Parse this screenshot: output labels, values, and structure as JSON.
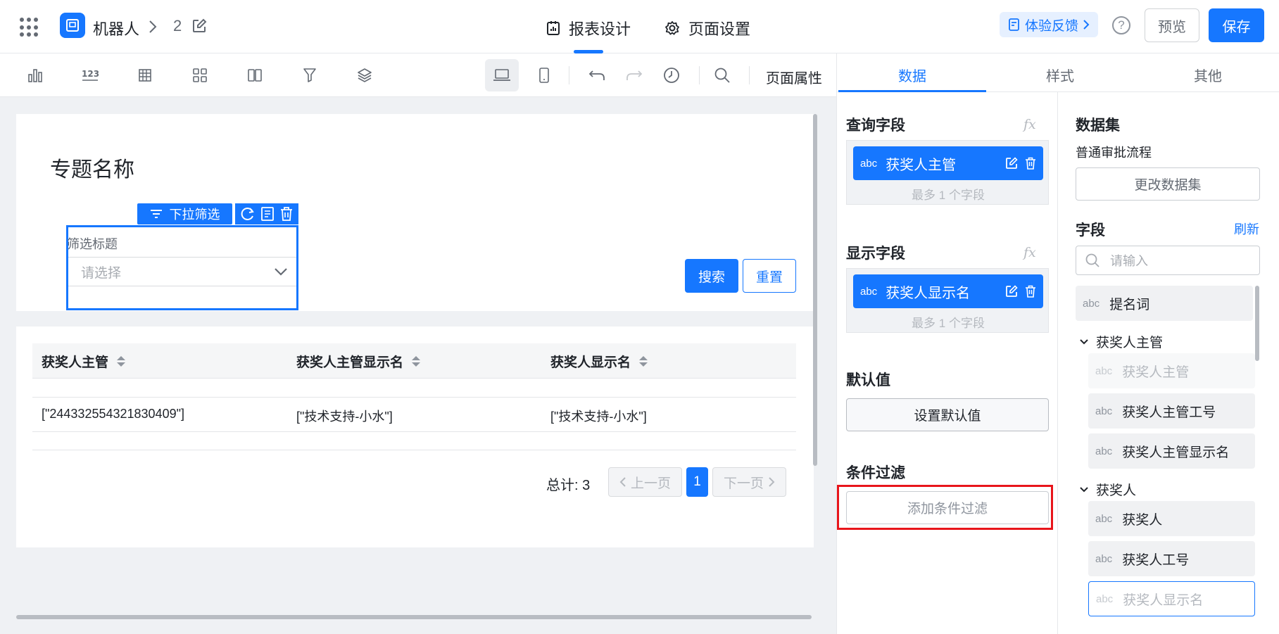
{
  "header": {
    "app_name": "机器人",
    "page_number": "2",
    "tabs": [
      {
        "label": "报表设计",
        "icon": "report-icon",
        "active": true
      },
      {
        "label": "页面设置",
        "icon": "gear-icon",
        "active": false
      }
    ],
    "feedback_label": "体验反馈",
    "help_label": "?",
    "preview_label": "预览",
    "save_label": "保存",
    "accent_color": "#1677ff"
  },
  "toolbar": {
    "icons": [
      "bar-chart-icon",
      "number-icon",
      "table-icon",
      "grid-icon",
      "columns-icon",
      "filter-icon",
      "layers-icon",
      "desktop-icon",
      "mobile-icon",
      "undo-icon",
      "redo-icon",
      "history-icon",
      "search-icon"
    ],
    "page_properties_label": "页面属性"
  },
  "canvas": {
    "title": "专题名称",
    "filter_widget": {
      "tag_label": "下拉筛选",
      "title": "筛选标题",
      "placeholder": "请选择"
    },
    "search_label": "搜索",
    "reset_label": "重置",
    "table": {
      "columns": [
        "获奖人主管",
        "获奖人主管显示名",
        "获奖人显示名"
      ],
      "rows": [
        [
          "[\"244332554321830409\"]",
          "[\"技术支持-小水\"]",
          "[\"技术支持-小水\"]"
        ]
      ]
    },
    "pagination": {
      "total_label": "总计: 3",
      "prev_label": "上一页",
      "current_page": "1",
      "next_label": "下一页"
    }
  },
  "right_panel": {
    "tabs": [
      "数据",
      "样式",
      "其他"
    ],
    "active_tab": "数据",
    "query_fields": {
      "title": "查询字段",
      "fx": "fx",
      "field_type": "abc",
      "field_label": "获奖人主管",
      "hint": "最多 1 个字段"
    },
    "display_fields": {
      "title": "显示字段",
      "fx": "fx",
      "field_type": "abc",
      "field_label": "获奖人显示名",
      "hint": "最多 1 个字段"
    },
    "default_value": {
      "title": "默认值",
      "button_label": "设置默认值"
    },
    "condition_filter": {
      "title": "条件过滤",
      "button_label": "添加条件过滤",
      "highlight_color": "#e8151b"
    },
    "dataset": {
      "title": "数据集",
      "name": "普通审批流程",
      "change_label": "更改数据集"
    },
    "fields": {
      "title": "字段",
      "refresh_label": "刷新",
      "search_placeholder": "请输入",
      "top_item": {
        "type": "abc",
        "label": "提名词"
      },
      "groups": [
        {
          "label": "获奖人主管",
          "items": [
            {
              "type": "abc",
              "label": "获奖人主管",
              "state": "disabled"
            },
            {
              "type": "abc",
              "label": "获奖人主管工号",
              "state": "normal"
            },
            {
              "type": "abc",
              "label": "获奖人主管显示名",
              "state": "normal"
            }
          ]
        },
        {
          "label": "获奖人",
          "items": [
            {
              "type": "abc",
              "label": "获奖人",
              "state": "normal"
            },
            {
              "type": "abc",
              "label": "获奖人工号",
              "state": "normal"
            },
            {
              "type": "abc",
              "label": "获奖人显示名",
              "state": "selected"
            }
          ]
        }
      ]
    }
  }
}
